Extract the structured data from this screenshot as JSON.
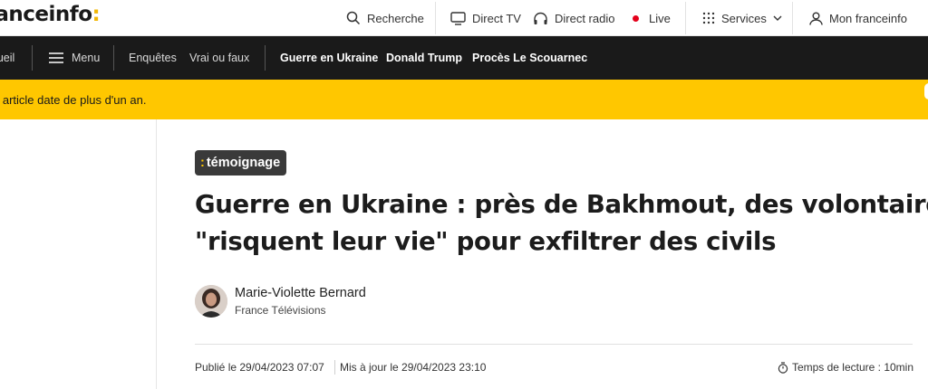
{
  "header": {
    "logo_text": "franceinfo",
    "logo_colon": ":",
    "search_label": "Recherche",
    "direct_tv_label": "Direct TV",
    "direct_radio_label": "Direct radio",
    "live_label": "Live",
    "services_label": "Services",
    "account_label": "Mon franceinfo"
  },
  "nav": {
    "home_label": "Accueil",
    "menu_label": "Menu",
    "items": [
      "Enquêtes",
      "Vrai ou faux"
    ],
    "trending": [
      "Guerre en Ukraine",
      "Donald Trump",
      "Procès Le Scouarnec"
    ]
  },
  "warning": {
    "text": "Cet article date de plus d'un an."
  },
  "article": {
    "tag_colon": ":",
    "tag": "témoignage",
    "title_line1": "Guerre en Ukraine : près de Bakhmout, des volontaires",
    "title_line2": "\"risquent leur vie\" pour exfiltrer des civils",
    "author_name": "Marie-Violette Bernard",
    "author_org": "France Télévisions",
    "published": "Publié le 29/04/2023 07:07",
    "updated": "Mis à jour le 29/04/2023 23:10",
    "reading_time": "Temps de lecture : 10min"
  },
  "colors": {
    "accent_yellow": "#ffc700",
    "nav_background": "#1a1a1a",
    "live_red": "#e4001b"
  }
}
